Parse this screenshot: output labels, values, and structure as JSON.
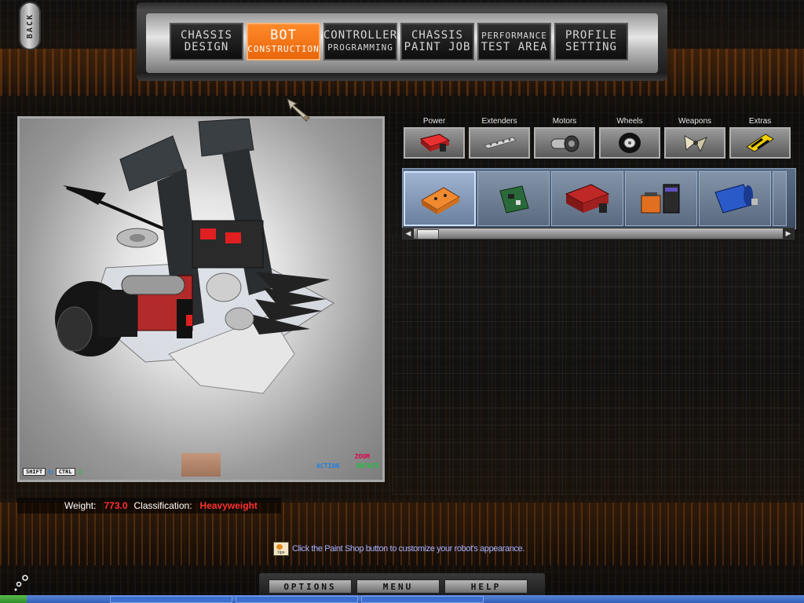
{
  "back": {
    "label": "BACK"
  },
  "nav": {
    "tabs": [
      {
        "line1": "CHASSIS",
        "line2": "DESIGN",
        "active": false
      },
      {
        "line1": "BOT",
        "line2": "CONSTRUCTION",
        "active": true
      },
      {
        "line1": "CONTROLLER",
        "line2": "PROGRAMMING",
        "active": false
      },
      {
        "line1": "CHASSIS",
        "line2": "PAINT JOB",
        "active": false
      },
      {
        "line1": "PERFORMANCE",
        "line2": "TEST AREA",
        "active": false
      },
      {
        "line1": "PROFILE",
        "line2": "SETTING",
        "active": false
      }
    ]
  },
  "categories": [
    {
      "label": "Power",
      "icon": "battery-icon"
    },
    {
      "label": "Extenders",
      "icon": "extender-bar-icon"
    },
    {
      "label": "Motors",
      "icon": "motor-icon"
    },
    {
      "label": "Wheels",
      "icon": "wheel-icon"
    },
    {
      "label": "Weapons",
      "icon": "blade-icon"
    },
    {
      "label": "Extras",
      "icon": "hazard-plate-icon"
    }
  ],
  "viewport": {
    "shift_key": "SHIFT",
    "ctrl_key": "CTRL",
    "zoom_label": "ZOOM",
    "action_label": "ACTION",
    "rotate_label": "ROTATE"
  },
  "stats": {
    "weight_label": "Weight:",
    "weight_value": "773.0",
    "classification_label": "Classification:",
    "classification_value": "Heavyweight"
  },
  "tip": {
    "icon_text": "tips",
    "text": "Click the Paint Shop button to customize your robot's appearance."
  },
  "bottom_menu": {
    "options": "OPTIONS",
    "menu": "MENU",
    "help": "HELP"
  },
  "colors": {
    "accent_orange": "#f07a1a",
    "value_red": "#ff3030",
    "tip_text": "#a9b2ff"
  }
}
